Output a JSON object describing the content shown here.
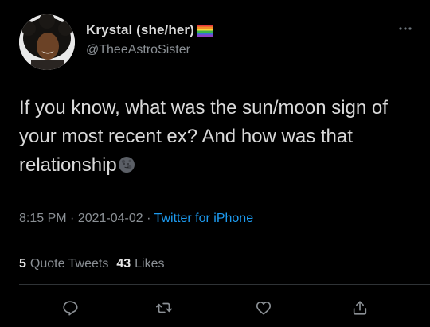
{
  "author": {
    "display_name": "Krystal (she/her)",
    "handle": "@TheeAstroSister",
    "avatar_icon": "avatar-photo",
    "flag_icon": "rainbow-flag-icon"
  },
  "tweet": {
    "text": "If you know, what was the sun/moon sign of your most recent ex? And how was that relationship",
    "emoji_icon": "new-moon-face-icon"
  },
  "meta": {
    "time": "8:15 PM",
    "separator1": " · ",
    "date": "2021-04-02",
    "separator2": " · ",
    "source": "Twitter for iPhone"
  },
  "stats": {
    "quote_tweets_count": "5",
    "quote_tweets_label": "Quote Tweets",
    "likes_count": "43",
    "likes_label": "Likes"
  },
  "actions": [
    "reply-icon",
    "retweet-icon",
    "like-icon",
    "share-icon"
  ],
  "colors": {
    "background": "#000000",
    "text": "#d9d9d9",
    "muted": "#8b9095",
    "link": "#1d9bf0",
    "divider": "#2f3336"
  }
}
